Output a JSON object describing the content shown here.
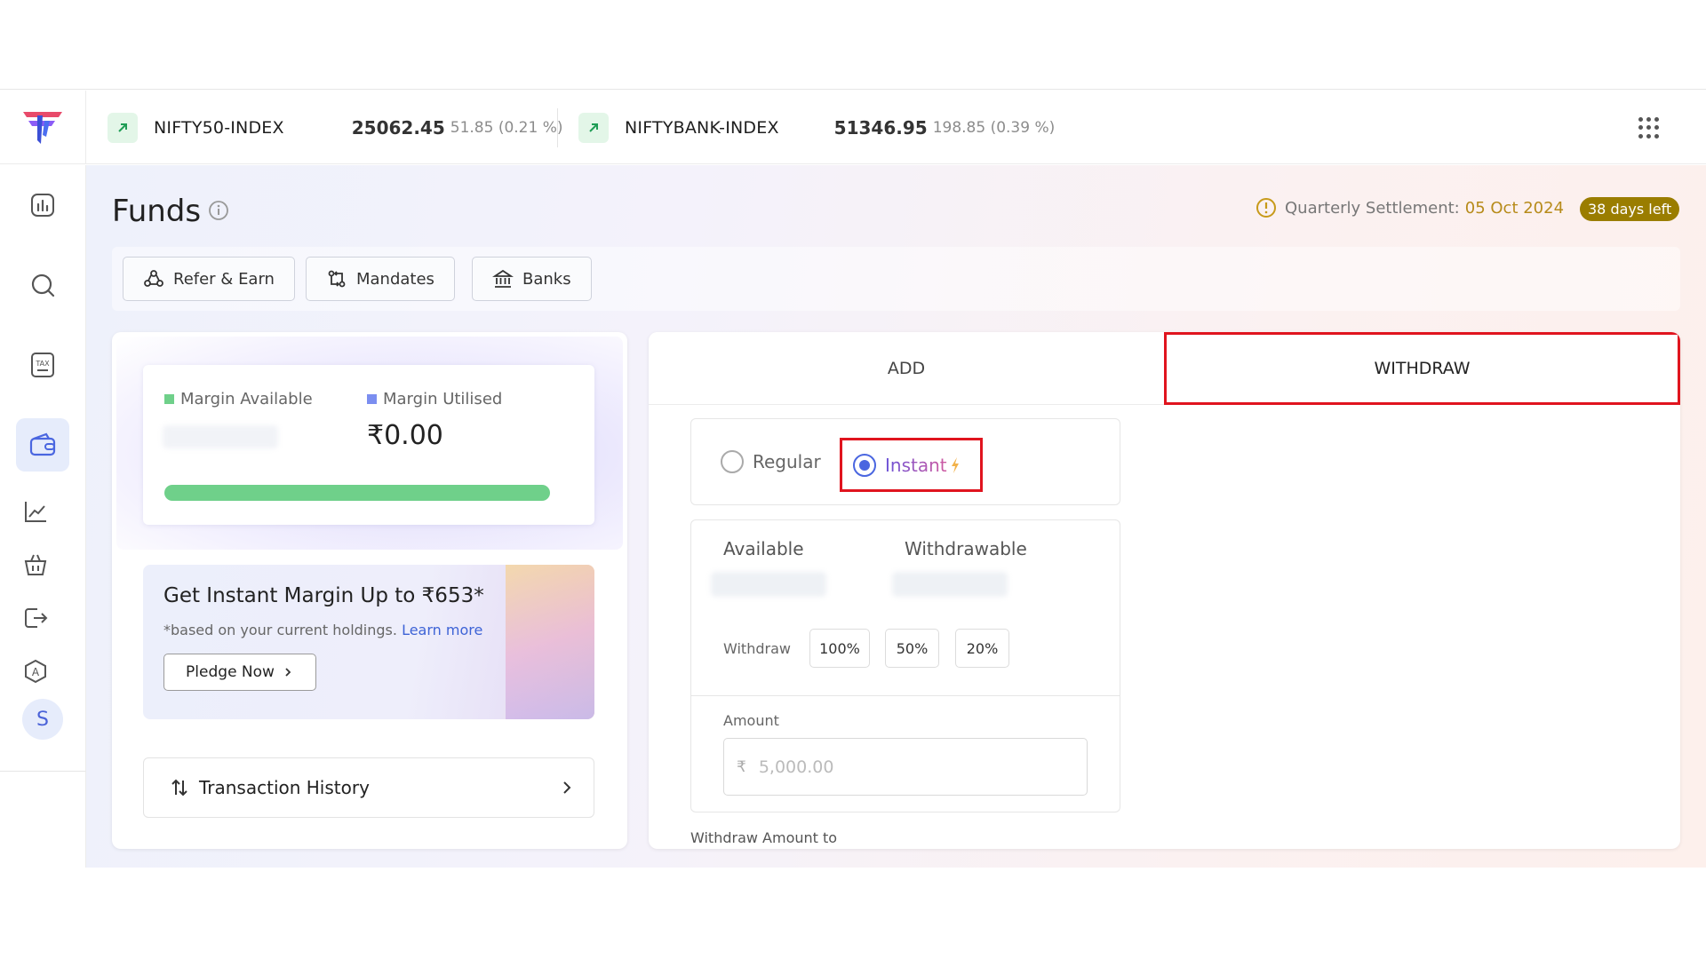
{
  "header": {
    "tickers": [
      {
        "name": "NIFTY50-INDEX",
        "price": "25062.45",
        "change": "51.85 (0.21 %)"
      },
      {
        "name": "NIFTYBANK-INDEX",
        "price": "51346.95",
        "change": "198.85 (0.39 %)"
      }
    ]
  },
  "sidebar": {
    "items": [
      "dashboard-icon",
      "search-icon",
      "tax-icon",
      "wallet-icon",
      "chart-icon",
      "basket-icon",
      "logout-icon",
      "algo-icon"
    ],
    "avatar_initial": "S"
  },
  "page": {
    "title": "Funds",
    "settlement_label": "Quarterly Settlement:",
    "settlement_date": "05 Oct 2024",
    "days_left": "38 days left"
  },
  "quick_actions": {
    "refer": "Refer & Earn",
    "mandates": "Mandates",
    "banks": "Banks"
  },
  "margin": {
    "available_label": "Margin Available",
    "utilised_label": "Margin Utilised",
    "utilised_value": "₹0.00",
    "available_color": "#6fd08a",
    "utilised_color": "#7b8ef0"
  },
  "pledge": {
    "title": "Get Instant Margin Up to ₹653*",
    "note": "*based on your current holdings.",
    "learn_more": "Learn more",
    "button": "Pledge Now"
  },
  "transactions": {
    "label": "Transaction History"
  },
  "tabs": {
    "add": "ADD",
    "withdraw": "WITHDRAW"
  },
  "withdraw": {
    "type_regular": "Regular",
    "type_instant": "Instant",
    "selected_type": "Instant",
    "available_label": "Available",
    "withdrawable_label": "Withdrawable",
    "withdraw_label": "Withdraw",
    "pct_options": [
      "100%",
      "50%",
      "20%"
    ],
    "amount_label": "Amount",
    "currency_symbol": "₹",
    "amount_placeholder": "5,000.00",
    "withdraw_to_label": "Withdraw Amount to"
  },
  "colors": {
    "accent": "#4a66e0",
    "highlight": "#e0141e",
    "badge": "#9a7d00",
    "settlement_date": "#b78b1a"
  }
}
